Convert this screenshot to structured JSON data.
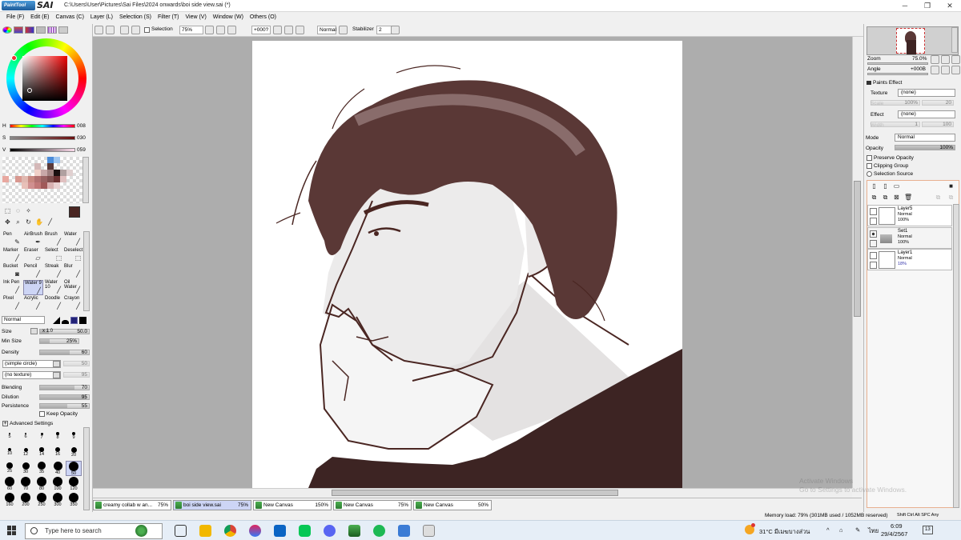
{
  "window": {
    "logo_text": "PaintTool",
    "logo_sai": "SAI",
    "title": "C:\\Users\\User\\Pictures\\Sai Files\\2024 onwards\\boi side view.sai (*)",
    "minimize": "─",
    "restore": "❐",
    "close": "✕"
  },
  "menu": [
    "File (F)",
    "Edit (E)",
    "Canvas (C)",
    "Layer (L)",
    "Selection (S)",
    "Filter (T)",
    "View (V)",
    "Window (W)",
    "Others (O)"
  ],
  "toolbar": {
    "selection_label": "Selection",
    "zoom": "75%",
    "angle": "+000?",
    "blend": "Normal",
    "stabilizer_label": "Stabilizer",
    "stabilizer": "2"
  },
  "color": {
    "current": "#4a2622",
    "h_label": "H",
    "h_value": "008",
    "s_label": "S",
    "s_value": "030",
    "v_label": "V",
    "v_value": "059",
    "swatches": [
      "#fff",
      "#fff",
      "#fff",
      "#fff",
      "#fff",
      "#fff",
      "#fff",
      "#4a8bd8",
      "#9ec6f0",
      "#fff",
      "#fff",
      "#fff",
      "#fff",
      "#fff",
      "#fff",
      "#fff",
      "#fff",
      "#fff",
      "#d4b8b8",
      "#fff",
      "#5a3a3a",
      "#fff",
      "#fff",
      "#fff",
      "#fff",
      "#fff",
      "#fff",
      "#fff",
      "#fff",
      "#fff",
      "#fff",
      "#f0d0c8",
      "#c8a8a8",
      "#a08080",
      "#1a1010",
      "#b0a0a0",
      "#e0d0d0",
      "#fff",
      "#fff",
      "#e8a8a0",
      "#fff",
      "#d89890",
      "#e0b8b0",
      "#c88880",
      "#b07070",
      "#986060",
      "#805050",
      "#6a3030",
      "#e0c0c0",
      "#fff",
      "#fff",
      "#fff",
      "#fff",
      "#fff",
      "#fff",
      "#e8c0b8",
      "#d09090",
      "#c07878",
      "#a05858",
      "#d8b0b0",
      "#e8d0d0",
      "#fff",
      "#fff",
      "#fff",
      "#fff",
      "#fff",
      "#fff",
      "#fff",
      "#fff",
      "#fff",
      "#fff",
      "#fff",
      "#fff",
      "#fff",
      "#fff",
      "#fff",
      "#fff",
      "#fff"
    ]
  },
  "tools": [
    {
      "label": "Pen",
      "icon": "✎"
    },
    {
      "label": "AirBrush",
      "icon": "✒"
    },
    {
      "label": "Brush",
      "icon": "╱"
    },
    {
      "label": "Water",
      "icon": "╱"
    },
    {
      "label": "Marker",
      "icon": "╱"
    },
    {
      "label": "Eraser",
      "icon": "▱"
    },
    {
      "label": "Select",
      "icon": "⬚"
    },
    {
      "label": "Deselect",
      "icon": "⬚"
    },
    {
      "label": "Bucket",
      "icon": "◙"
    },
    {
      "label": "Pencil",
      "icon": "╱"
    },
    {
      "label": "Streak",
      "icon": "╱"
    },
    {
      "label": "Blur",
      "icon": "╱"
    },
    {
      "label": "Ink Pen",
      "icon": "╱"
    },
    {
      "label": "Water 9",
      "icon": "╱"
    },
    {
      "label": "Water 10",
      "icon": "╱"
    },
    {
      "label": "Oil Water",
      "icon": "╱"
    },
    {
      "label": "Pixel",
      "icon": "╱"
    },
    {
      "label": "Acrylic",
      "icon": "╱"
    },
    {
      "label": "Doodle",
      "icon": "╱"
    },
    {
      "label": "Crayon",
      "icon": "╱"
    }
  ],
  "brush": {
    "blend": "Normal",
    "size_label": "Size",
    "size_mult": "x 1.0",
    "size": "50.0",
    "min_size_label": "Min Size",
    "min_size": "25%",
    "density_label": "Density",
    "density": "60",
    "shape": "(simple circle)",
    "shape_val": "50",
    "texture": "(no texture)",
    "texture_val": "95",
    "blending_label": "Blending",
    "blending": "70",
    "dilution_label": "Dilution",
    "dilution": "95",
    "persistence_label": "Persistence",
    "persistence": "55",
    "keep_opacity": "Keep Opacity",
    "advanced": "Advanced Settings",
    "sizes": [
      "5",
      "6",
      "7",
      "8",
      "9",
      "10",
      "12",
      "14",
      "16",
      "20",
      "25",
      "30",
      "35",
      "40",
      "50",
      "60",
      "70",
      "80",
      "100",
      "120",
      "160",
      "200",
      "250",
      "300",
      "350"
    ]
  },
  "nav": {
    "zoom_label": "Zoom",
    "zoom": "75.0%",
    "angle_label": "Angle",
    "angle": "+000B"
  },
  "paint_effect": {
    "header": "Paints Effect",
    "texture_label": "Texture",
    "texture": "(none)",
    "scale_label": "Scale",
    "scale": "100%",
    "scale_val": "20",
    "effect_label": "Effect",
    "effect": "(none)",
    "width_label": "Width",
    "width": "1",
    "width_val": "100"
  },
  "layer_props": {
    "mode_label": "Mode",
    "mode": "Normal",
    "opacity_label": "Opacity",
    "opacity": "100%",
    "preserve": "Preserve Opacity",
    "clipping": "Clipping Group",
    "sel_source": "Selection Source"
  },
  "layers": [
    {
      "name": "Layer5",
      "mode": "Normal",
      "opacity": "100%"
    },
    {
      "name": "Set1",
      "mode": "Normal",
      "opacity": "100%"
    },
    {
      "name": "Layer1",
      "mode": "Normal",
      "opacity": "18%"
    }
  ],
  "doc_tabs": [
    {
      "name": "creamy collab w an...",
      "zoom": "75%"
    },
    {
      "name": "boi side view.sai",
      "zoom": "75%"
    },
    {
      "name": "New Canvas",
      "zoom": "150%"
    },
    {
      "name": "New Canvas",
      "zoom": "75%"
    },
    {
      "name": "New Canvas",
      "zoom": "50%"
    }
  ],
  "status": {
    "memory": "Memory load: 79% (301MB used / 1052MB reserved)",
    "keys": "Shift Ctrl Alt SPC Any"
  },
  "watermark": {
    "line1": "Activate Windows",
    "line2": "Go to Settings to activate Windows."
  },
  "taskbar": {
    "search": "Type here to search",
    "weather": "31°C  มีเมฆบางส่วน",
    "lang": "ไทย",
    "time": "6:09",
    "date": "29/4/2567",
    "badge": "13"
  }
}
